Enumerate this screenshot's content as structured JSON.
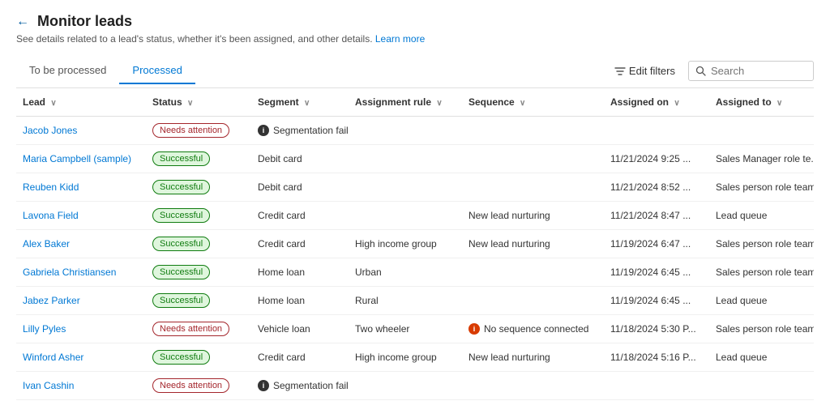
{
  "header": {
    "back_label": "←",
    "title": "Monitor leads",
    "subtitle": "See details related to a lead's status, whether it's been assigned, and other details.",
    "learn_more": "Learn more"
  },
  "tabs": [
    {
      "id": "to-be-processed",
      "label": "To be processed",
      "active": false
    },
    {
      "id": "processed",
      "label": "Processed",
      "active": true
    }
  ],
  "toolbar": {
    "edit_filters_label": "Edit filters",
    "search_placeholder": "Search"
  },
  "table": {
    "columns": [
      {
        "id": "lead",
        "label": "Lead",
        "sortable": true
      },
      {
        "id": "status",
        "label": "Status",
        "sortable": true
      },
      {
        "id": "segment",
        "label": "Segment",
        "sortable": true
      },
      {
        "id": "assignment_rule",
        "label": "Assignment rule",
        "sortable": true
      },
      {
        "id": "sequence",
        "label": "Sequence",
        "sortable": true
      },
      {
        "id": "assigned_on",
        "label": "Assigned on",
        "sortable": true
      },
      {
        "id": "assigned_to",
        "label": "Assigned to",
        "sortable": true
      }
    ],
    "rows": [
      {
        "lead": "Jacob Jones",
        "status": "Needs attention",
        "status_type": "attention",
        "segment": "Segmentation failed",
        "segment_type": "failed",
        "assignment_rule": "",
        "sequence": "",
        "sequence_type": "normal",
        "assigned_on": "",
        "assigned_to": ""
      },
      {
        "lead": "Maria Campbell (sample)",
        "status": "Successful",
        "status_type": "success",
        "segment": "Debit card",
        "segment_type": "normal",
        "assignment_rule": "",
        "sequence": "",
        "sequence_type": "normal",
        "assigned_on": "11/21/2024 9:25 ...",
        "assigned_to": "Sales Manager role te..."
      },
      {
        "lead": "Reuben Kidd",
        "status": "Successful",
        "status_type": "success",
        "segment": "Debit card",
        "segment_type": "normal",
        "assignment_rule": "",
        "sequence": "",
        "sequence_type": "normal",
        "assigned_on": "11/21/2024 8:52 ...",
        "assigned_to": "Sales person role team"
      },
      {
        "lead": "Lavona Field",
        "status": "Successful",
        "status_type": "success",
        "segment": "Credit card",
        "segment_type": "normal",
        "assignment_rule": "",
        "sequence": "New lead nurturing",
        "sequence_type": "normal",
        "assigned_on": "11/21/2024 8:47 ...",
        "assigned_to": "Lead queue"
      },
      {
        "lead": "Alex Baker",
        "status": "Successful",
        "status_type": "success",
        "segment": "Credit card",
        "segment_type": "normal",
        "assignment_rule": "High income group",
        "sequence": "New lead nurturing",
        "sequence_type": "normal",
        "assigned_on": "11/19/2024 6:47 ...",
        "assigned_to": "Sales person role team"
      },
      {
        "lead": "Gabriela Christiansen",
        "status": "Successful",
        "status_type": "success",
        "segment": "Home loan",
        "segment_type": "normal",
        "assignment_rule": "Urban",
        "sequence": "",
        "sequence_type": "normal",
        "assigned_on": "11/19/2024 6:45 ...",
        "assigned_to": "Sales person role team"
      },
      {
        "lead": "Jabez Parker",
        "status": "Successful",
        "status_type": "success",
        "segment": "Home loan",
        "segment_type": "normal",
        "assignment_rule": "Rural",
        "sequence": "",
        "sequence_type": "normal",
        "assigned_on": "11/19/2024 6:45 ...",
        "assigned_to": "Lead queue"
      },
      {
        "lead": "Lilly Pyles",
        "status": "Needs attention",
        "status_type": "attention",
        "segment": "Vehicle loan",
        "segment_type": "normal",
        "assignment_rule": "Two wheeler",
        "sequence": "No sequence connected",
        "sequence_type": "warning",
        "assigned_on": "11/18/2024 5:30 P...",
        "assigned_to": "Sales person role team"
      },
      {
        "lead": "Winford Asher",
        "status": "Successful",
        "status_type": "success",
        "segment": "Credit card",
        "segment_type": "normal",
        "assignment_rule": "High income group",
        "sequence": "New lead nurturing",
        "sequence_type": "normal",
        "assigned_on": "11/18/2024 5:16 P...",
        "assigned_to": "Lead queue"
      },
      {
        "lead": "Ivan Cashin",
        "status": "Needs attention",
        "status_type": "attention",
        "segment": "Segmentation failed",
        "segment_type": "failed",
        "assignment_rule": "",
        "sequence": "",
        "sequence_type": "normal",
        "assigned_on": "",
        "assigned_to": ""
      }
    ]
  }
}
